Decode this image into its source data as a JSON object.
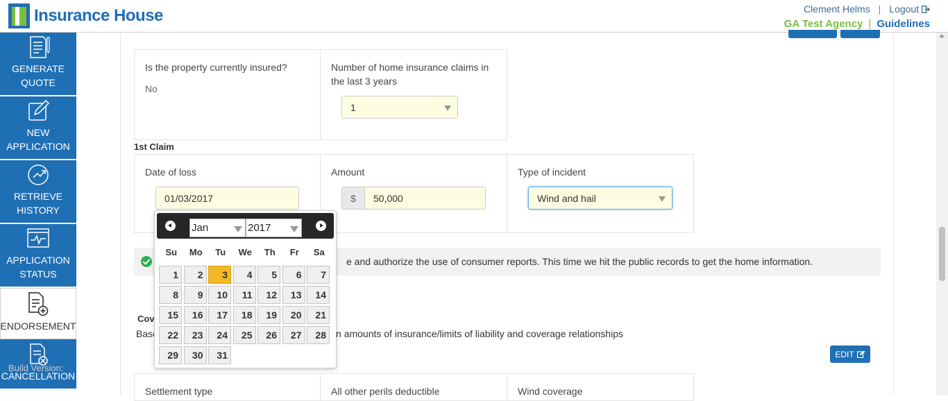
{
  "header": {
    "logo_text": "Insurance House",
    "user_name": "Clement Helms",
    "logout_label": "Logout",
    "agency_label": "GA Test Agency",
    "guidelines_label": "Guidelines"
  },
  "sidebar": {
    "items": [
      {
        "label": "GENERATE QUOTE",
        "icon": "document-icon"
      },
      {
        "label": "NEW APPLICATION",
        "icon": "pencil-icon"
      },
      {
        "label": "RETRIEVE HISTORY",
        "icon": "history-icon"
      },
      {
        "label": "APPLICATION STATUS",
        "icon": "chart-icon"
      },
      {
        "label": "ENDORSEMENT",
        "icon": "document-add-icon"
      },
      {
        "label": "CANCELLATION",
        "icon": "document-cancel-icon"
      }
    ],
    "build_version": "Build Version:"
  },
  "form": {
    "insured_question": "Is the property currently insured?",
    "insured_answer": "No",
    "claims_question": "Number of home insurance claims in the last 3 years",
    "claims_value": "1",
    "claim_section": "1st Claim",
    "date_of_loss_label": "Date of loss",
    "date_of_loss_value": "01/03/2017",
    "amount_label": "Amount",
    "amount_prefix": "$",
    "amount_value": "50,000",
    "incident_label": "Type of incident",
    "incident_value": "Wind and hail",
    "notice_text": "e and authorize the use of consumer reports. This time we hit the public records to get the home information.",
    "coverage_title": "Cov",
    "coverage_desc_start": "Base",
    "coverage_desc_end": "n amounts of insurance/limits of liability and coverage relationships",
    "edit_label": "EDIT",
    "settlement_label": "Settlement type",
    "deductible_label": "All other perils deductible",
    "wind_label": "Wind coverage"
  },
  "datepicker": {
    "month": "Jan",
    "year": "2017",
    "weekdays": [
      "Su",
      "Mo",
      "Tu",
      "We",
      "Th",
      "Fr",
      "Sa"
    ],
    "days": [
      "1",
      "2",
      "3",
      "4",
      "5",
      "6",
      "7",
      "8",
      "9",
      "10",
      "11",
      "12",
      "13",
      "14",
      "15",
      "16",
      "17",
      "18",
      "19",
      "20",
      "21",
      "22",
      "23",
      "24",
      "25",
      "26",
      "27",
      "28",
      "29",
      "30",
      "31"
    ],
    "selected_day": "3"
  },
  "colors": {
    "brand_blue": "#1f6fb5",
    "brand_green": "#7dbb42",
    "highlight": "#f3b827",
    "success": "#2eab4f"
  }
}
